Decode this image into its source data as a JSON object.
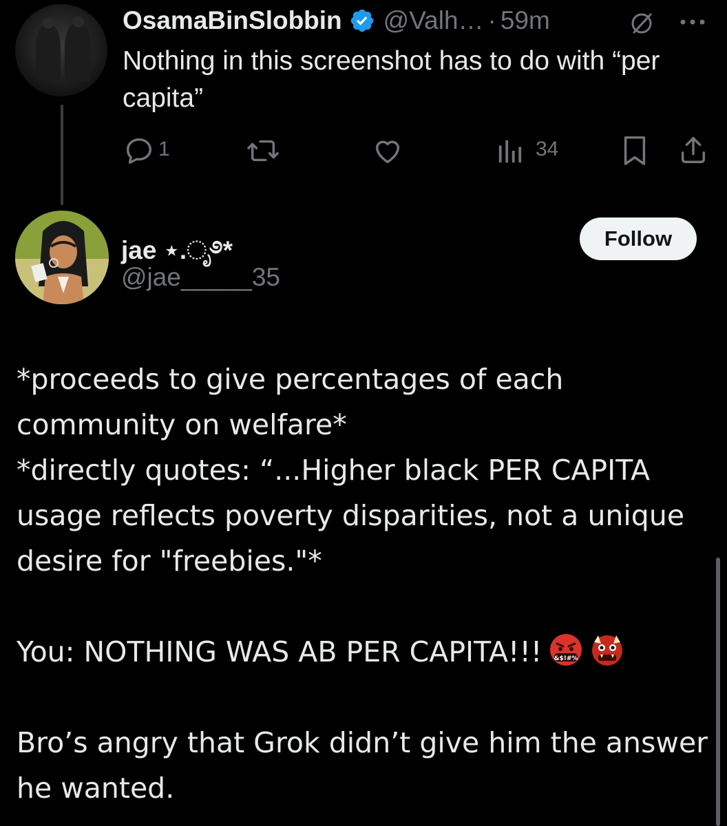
{
  "parent_tweet": {
    "display_name": "OsamaBinSlobbin",
    "handle": "@Valh…",
    "separator": "·",
    "time": "59m",
    "text": "Nothing in this screenshot has to do with “per capita”",
    "reply_count": "1",
    "view_count": "34",
    "icons": {
      "verified": "verified-badge-icon",
      "mute": "mute-icon",
      "more": "more-icon",
      "reply": "reply-icon",
      "retweet": "retweet-icon",
      "like": "heart-icon",
      "views": "views-icon",
      "bookmark": "bookmark-icon",
      "share": "share-icon"
    }
  },
  "reply_tweet": {
    "display_name": "jae ⋆.ೃ࿔*",
    "handle": "@jae_____35",
    "follow_label": "Follow",
    "body": {
      "line1": "*proceeds to give percentages of each community on welfare*",
      "line2": "*directly quotes: “...Higher black PER CAPITA usage reflects poverty disparities, not a unique desire for \"freebies.\"*",
      "line3": "You: NOTHING WAS AB PER CAPITA!!!",
      "line4": "Bro’s angry that Grok didn’t give him the answer he wanted."
    },
    "emojis": [
      "face-with-symbols-on-mouth-emoji",
      "ogre-emoji"
    ]
  },
  "colors": {
    "background": "#000000",
    "text_primary": "#e7e9ea",
    "text_secondary": "#71767b",
    "verified_blue": "#1d9bf0",
    "follow_bg": "#eff3f4",
    "follow_text": "#0f1419"
  }
}
